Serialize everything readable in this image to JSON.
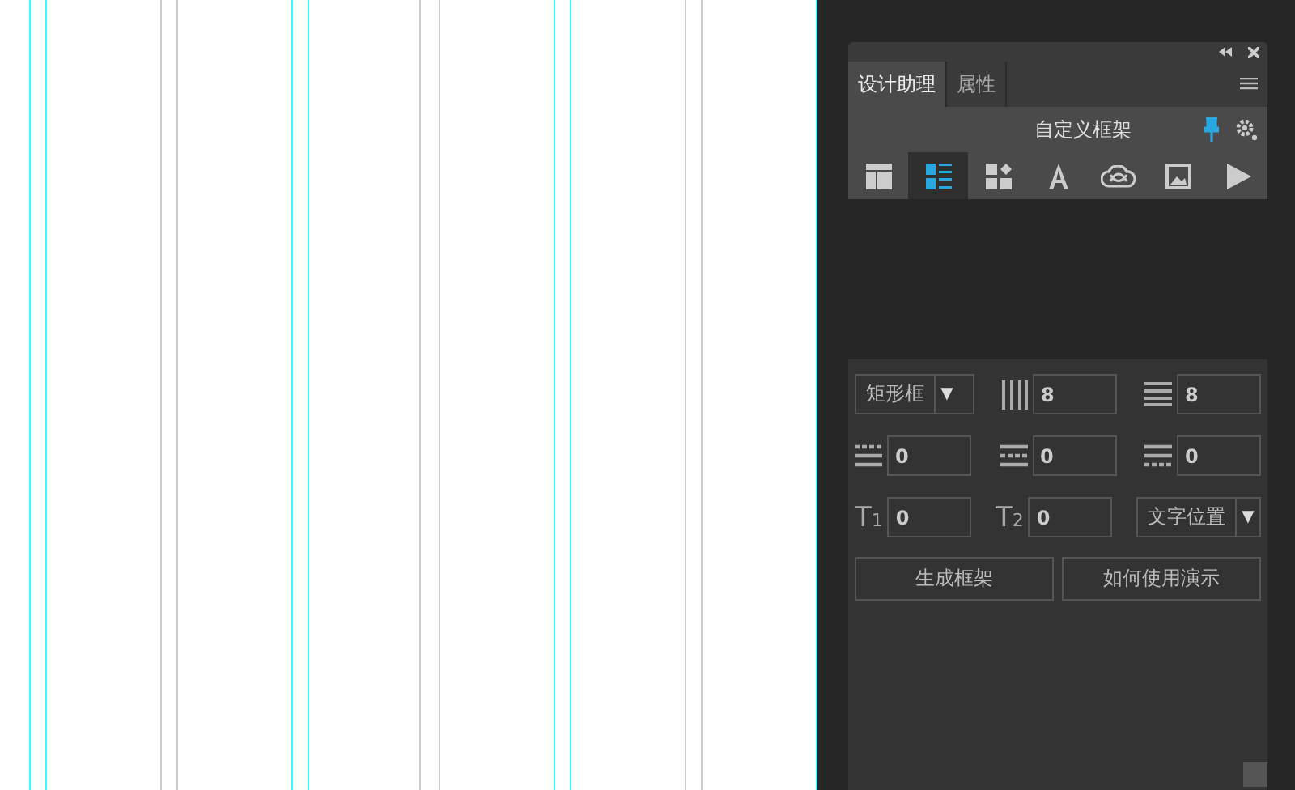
{
  "panel": {
    "tabs": [
      {
        "label": "设计助理",
        "selected": true
      },
      {
        "label": "属性",
        "selected": false
      }
    ],
    "header": {
      "title": "自定义框架"
    },
    "toolbar": [
      {
        "kind": "layout",
        "selected": false
      },
      {
        "kind": "list",
        "selected": true
      },
      {
        "kind": "widgets",
        "selected": false
      },
      {
        "kind": "text",
        "selected": false
      },
      {
        "kind": "cloud",
        "selected": false
      },
      {
        "kind": "image",
        "selected": false
      },
      {
        "kind": "play",
        "selected": false
      }
    ],
    "frame_type": {
      "value": "矩形框",
      "arrow": "▼"
    },
    "columns": {
      "kind": "columns",
      "value": "8"
    },
    "rows": {
      "kind": "rows",
      "value": "8"
    },
    "spacing": [
      {
        "kind": "dash-top",
        "value": "0"
      },
      {
        "kind": "dash-mid",
        "value": "0"
      },
      {
        "kind": "dash-bottom",
        "value": "0"
      }
    ],
    "text_fields": [
      {
        "glyph": "T",
        "sub": "1",
        "value": "0"
      },
      {
        "glyph": "T",
        "sub": "2",
        "value": "0"
      }
    ],
    "text_position": {
      "value": "文字位置",
      "arrow": "▼"
    },
    "buttons": [
      "生成框架",
      "如何使用演示"
    ]
  }
}
